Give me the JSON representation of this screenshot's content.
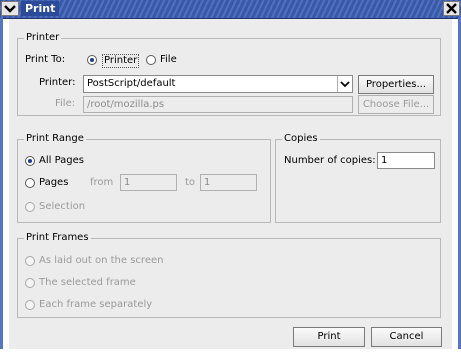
{
  "window": {
    "title": "Print",
    "menu_icon": "chevron-down-icon",
    "close_icon": "close-x-icon"
  },
  "printer": {
    "group_label": "Printer",
    "print_to_label": "Print To:",
    "option_printer": "Printer",
    "option_file": "File",
    "selected_destination": "Printer",
    "printer_label": "Printer:",
    "printer_value": "PostScript/default",
    "properties_button": "Properties...",
    "file_label": "File:",
    "file_value": "/root/mozilla.ps",
    "choose_file_button": "Choose File..."
  },
  "print_range": {
    "group_label": "Print Range",
    "all_pages": "All Pages",
    "pages": "Pages",
    "from_label": "from",
    "from_value": "1",
    "to_label": "to",
    "to_value": "1",
    "selection": "Selection",
    "selected": "All Pages"
  },
  "copies": {
    "group_label": "Copies",
    "number_label": "Number of copies:",
    "number_value": "1"
  },
  "print_frames": {
    "group_label": "Print Frames",
    "as_laid_out": "As laid out on the screen",
    "selected_frame": "The selected frame",
    "each_frame": "Each frame separately"
  },
  "actions": {
    "print_button": "Print",
    "cancel_button": "Cancel"
  },
  "colors": {
    "titlebar": "#3a58a8",
    "dialog_bg": "#ececec",
    "radio_dot": "#1c3e8c"
  }
}
